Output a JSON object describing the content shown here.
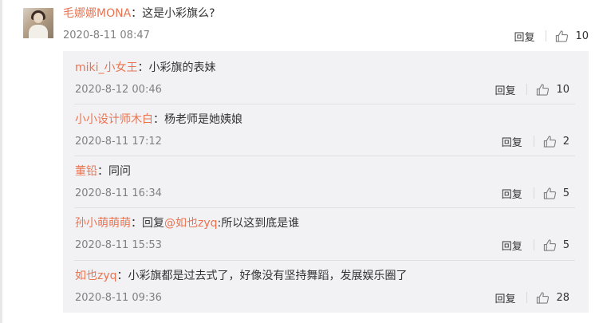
{
  "main_comment": {
    "username": "毛娜娜MONA",
    "separator": "：",
    "text": "这是小彩旗么?",
    "time": "2020-8-11 08:47",
    "reply_label": "回复",
    "likes": "10"
  },
  "replies": [
    {
      "username": "miki_小女王",
      "separator": "：",
      "text": "小彩旗的表妹",
      "time": "2020-8-12 00:46",
      "reply_label": "回复",
      "likes": "10"
    },
    {
      "username": "小小设计师木白",
      "separator": "：",
      "text": "杨老师是她姨娘",
      "time": "2020-8-11 17:12",
      "reply_label": "回复",
      "likes": "2"
    },
    {
      "username": "董铅",
      "separator": "：",
      "text": "同问",
      "time": "2020-8-11 16:34",
      "reply_label": "回复",
      "likes": "5"
    },
    {
      "username": "孙小萌萌萌",
      "separator": "：",
      "text_prefix": "回复",
      "mention": "@如也zyq",
      "text": ":所以这到底是谁",
      "time": "2020-8-11 15:53",
      "reply_label": "回复",
      "likes": "5"
    },
    {
      "username": "如也zyq",
      "separator": "：",
      "text": "小彩旗都是过去式了，好像没有坚持舞蹈，发展娱乐圈了",
      "time": "2020-8-11 09:36",
      "reply_label": "回复",
      "likes": "28"
    }
  ],
  "colors": {
    "username": "#eb7350",
    "text": "#333333",
    "time": "#808080",
    "sub_bg": "#f2f2f5"
  },
  "icons": {
    "like": "thumbs-up-icon",
    "avatar": "user-avatar-photo"
  }
}
